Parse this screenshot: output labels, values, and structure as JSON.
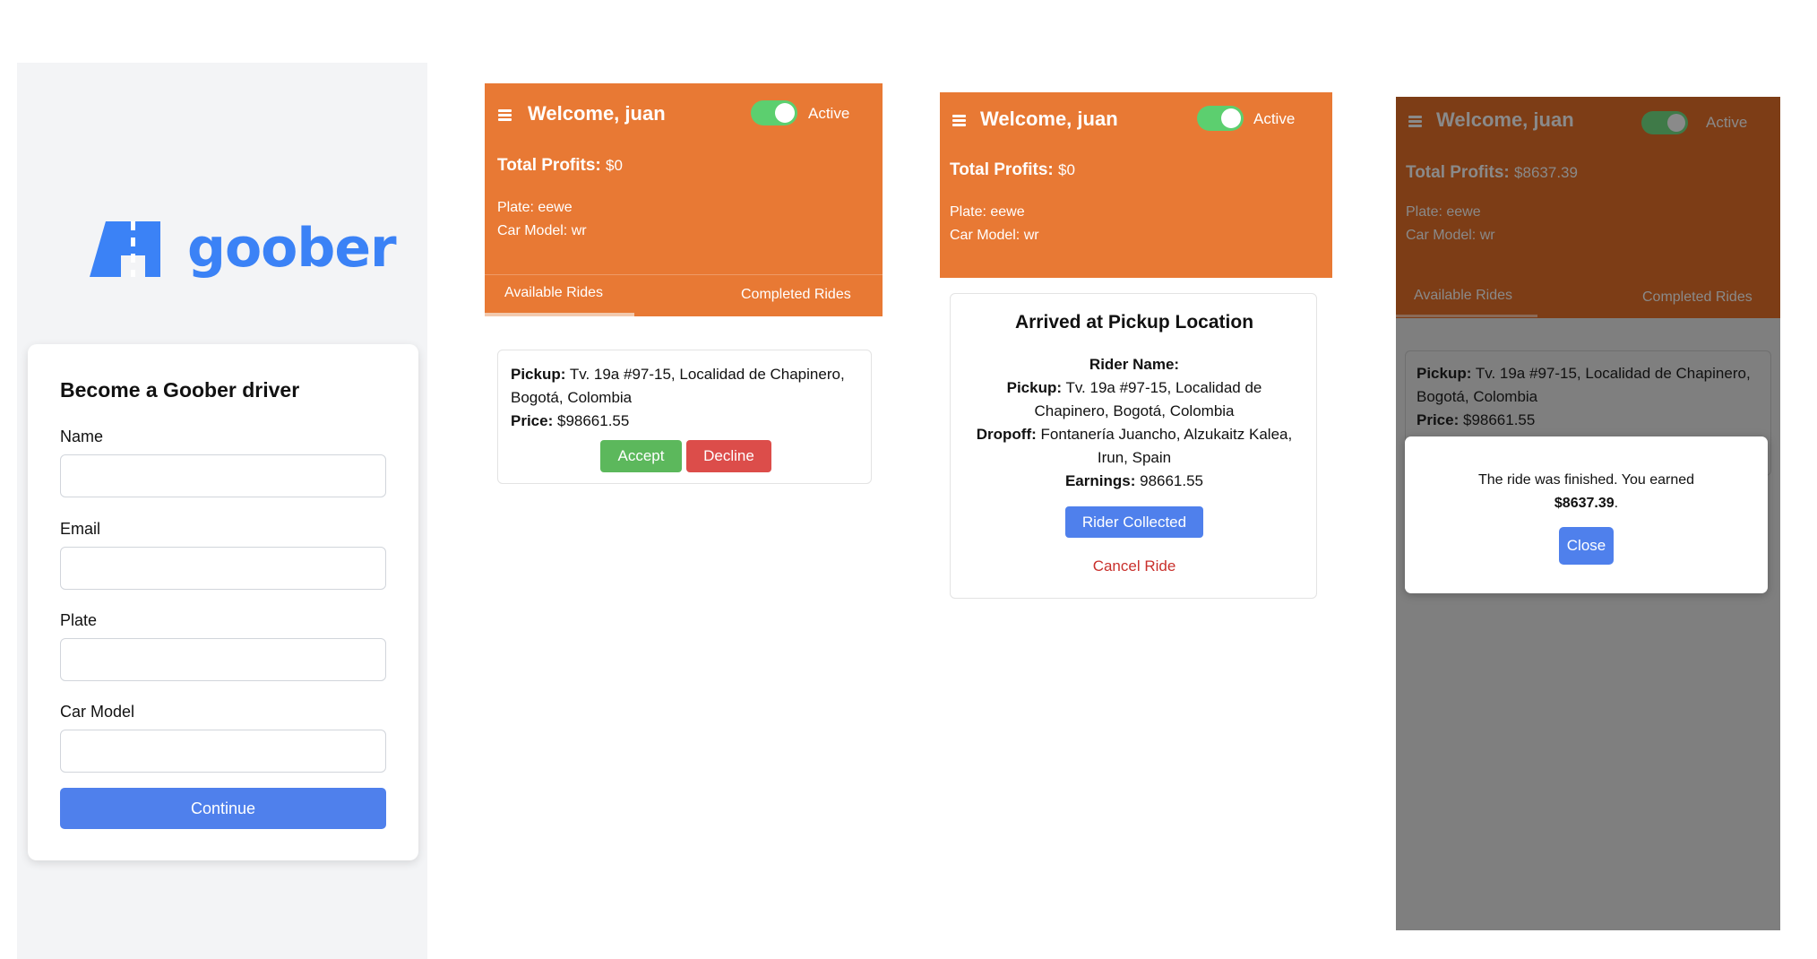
{
  "register": {
    "logo_text": "goober",
    "title": "Become a Goober driver",
    "fields": [
      {
        "label": "Name",
        "value": ""
      },
      {
        "label": "Email",
        "value": ""
      },
      {
        "label": "Plate",
        "value": ""
      },
      {
        "label": "Car Model",
        "value": ""
      }
    ],
    "continue_label": "Continue"
  },
  "dashboard": {
    "welcome": "Welcome, juan",
    "status_label": "Active",
    "status_on": true,
    "profits_label": "Total Profits:",
    "profits_value": "$0",
    "plate": "Plate: eewe",
    "car_model": "Car Model: wr",
    "tabs": [
      "Available Rides",
      "Completed Rides"
    ],
    "ride": {
      "pickup_label": "Pickup:",
      "pickup_value": "Tv. 19a #97-15, Localidad de Chapinero, Bogotá, Colombia",
      "price_label": "Price:",
      "price_value": "$98661.55",
      "accept_label": "Accept",
      "decline_label": "Decline"
    }
  },
  "pickup": {
    "welcome": "Welcome, juan",
    "status_label": "Active",
    "profits_label": "Total Profits:",
    "profits_value": "$0",
    "plate": "Plate: eewe",
    "car_model": "Car Model: wr",
    "card_title": "Arrived at Pickup Location",
    "rider_name_label": "Rider Name:",
    "pickup_label": "Pickup:",
    "pickup_value": "Tv. 19a #97-15, Localidad de Chapinero, Bogotá, Colombia",
    "dropoff_label": "Dropoff:",
    "dropoff_value": "Fontanería Juancho, Alzukaitz Kalea, Irun, Spain",
    "earnings_label": "Earnings:",
    "earnings_value": "98661.55",
    "collected_label": "Rider Collected",
    "cancel_label": "Cancel Ride"
  },
  "finished": {
    "welcome": "Welcome, juan",
    "status_label": "Active",
    "profits_label": "Total Profits:",
    "profits_value": "$8637.39",
    "plate": "Plate: eewe",
    "car_model": "Car Model: wr",
    "tabs": [
      "Available Rides",
      "Completed Rides"
    ],
    "pickup_label": "Pickup:",
    "pickup_value": "Tv. 19a #97-15, Localidad de Chapinero, Bogotá, Colombia",
    "price_label": "Price:",
    "price_value": "$98661.55",
    "modal_text": "The ride was finished. You earned",
    "modal_amount": "$8637.39",
    "modal_period": ".",
    "close_label": "Close"
  },
  "colors": {
    "brand_blue": "#3b82f6",
    "header_orange": "#e87934",
    "accept_green": "#5cb85c",
    "decline_red": "#dc4d4a",
    "toggle_green": "#5ccf6f"
  }
}
